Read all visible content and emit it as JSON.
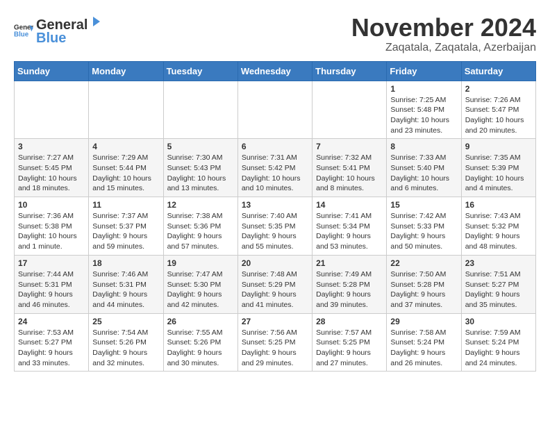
{
  "header": {
    "logo_general": "General",
    "logo_blue": "Blue",
    "month_title": "November 2024",
    "location": "Zaqatala, Zaqatala, Azerbaijan"
  },
  "days_of_week": [
    "Sunday",
    "Monday",
    "Tuesday",
    "Wednesday",
    "Thursday",
    "Friday",
    "Saturday"
  ],
  "weeks": [
    [
      {
        "day": "",
        "info": ""
      },
      {
        "day": "",
        "info": ""
      },
      {
        "day": "",
        "info": ""
      },
      {
        "day": "",
        "info": ""
      },
      {
        "day": "",
        "info": ""
      },
      {
        "day": "1",
        "info": "Sunrise: 7:25 AM\nSunset: 5:48 PM\nDaylight: 10 hours and 23 minutes."
      },
      {
        "day": "2",
        "info": "Sunrise: 7:26 AM\nSunset: 5:47 PM\nDaylight: 10 hours and 20 minutes."
      }
    ],
    [
      {
        "day": "3",
        "info": "Sunrise: 7:27 AM\nSunset: 5:45 PM\nDaylight: 10 hours and 18 minutes."
      },
      {
        "day": "4",
        "info": "Sunrise: 7:29 AM\nSunset: 5:44 PM\nDaylight: 10 hours and 15 minutes."
      },
      {
        "day": "5",
        "info": "Sunrise: 7:30 AM\nSunset: 5:43 PM\nDaylight: 10 hours and 13 minutes."
      },
      {
        "day": "6",
        "info": "Sunrise: 7:31 AM\nSunset: 5:42 PM\nDaylight: 10 hours and 10 minutes."
      },
      {
        "day": "7",
        "info": "Sunrise: 7:32 AM\nSunset: 5:41 PM\nDaylight: 10 hours and 8 minutes."
      },
      {
        "day": "8",
        "info": "Sunrise: 7:33 AM\nSunset: 5:40 PM\nDaylight: 10 hours and 6 minutes."
      },
      {
        "day": "9",
        "info": "Sunrise: 7:35 AM\nSunset: 5:39 PM\nDaylight: 10 hours and 4 minutes."
      }
    ],
    [
      {
        "day": "10",
        "info": "Sunrise: 7:36 AM\nSunset: 5:38 PM\nDaylight: 10 hours and 1 minute."
      },
      {
        "day": "11",
        "info": "Sunrise: 7:37 AM\nSunset: 5:37 PM\nDaylight: 9 hours and 59 minutes."
      },
      {
        "day": "12",
        "info": "Sunrise: 7:38 AM\nSunset: 5:36 PM\nDaylight: 9 hours and 57 minutes."
      },
      {
        "day": "13",
        "info": "Sunrise: 7:40 AM\nSunset: 5:35 PM\nDaylight: 9 hours and 55 minutes."
      },
      {
        "day": "14",
        "info": "Sunrise: 7:41 AM\nSunset: 5:34 PM\nDaylight: 9 hours and 53 minutes."
      },
      {
        "day": "15",
        "info": "Sunrise: 7:42 AM\nSunset: 5:33 PM\nDaylight: 9 hours and 50 minutes."
      },
      {
        "day": "16",
        "info": "Sunrise: 7:43 AM\nSunset: 5:32 PM\nDaylight: 9 hours and 48 minutes."
      }
    ],
    [
      {
        "day": "17",
        "info": "Sunrise: 7:44 AM\nSunset: 5:31 PM\nDaylight: 9 hours and 46 minutes."
      },
      {
        "day": "18",
        "info": "Sunrise: 7:46 AM\nSunset: 5:31 PM\nDaylight: 9 hours and 44 minutes."
      },
      {
        "day": "19",
        "info": "Sunrise: 7:47 AM\nSunset: 5:30 PM\nDaylight: 9 hours and 42 minutes."
      },
      {
        "day": "20",
        "info": "Sunrise: 7:48 AM\nSunset: 5:29 PM\nDaylight: 9 hours and 41 minutes."
      },
      {
        "day": "21",
        "info": "Sunrise: 7:49 AM\nSunset: 5:28 PM\nDaylight: 9 hours and 39 minutes."
      },
      {
        "day": "22",
        "info": "Sunrise: 7:50 AM\nSunset: 5:28 PM\nDaylight: 9 hours and 37 minutes."
      },
      {
        "day": "23",
        "info": "Sunrise: 7:51 AM\nSunset: 5:27 PM\nDaylight: 9 hours and 35 minutes."
      }
    ],
    [
      {
        "day": "24",
        "info": "Sunrise: 7:53 AM\nSunset: 5:27 PM\nDaylight: 9 hours and 33 minutes."
      },
      {
        "day": "25",
        "info": "Sunrise: 7:54 AM\nSunset: 5:26 PM\nDaylight: 9 hours and 32 minutes."
      },
      {
        "day": "26",
        "info": "Sunrise: 7:55 AM\nSunset: 5:26 PM\nDaylight: 9 hours and 30 minutes."
      },
      {
        "day": "27",
        "info": "Sunrise: 7:56 AM\nSunset: 5:25 PM\nDaylight: 9 hours and 29 minutes."
      },
      {
        "day": "28",
        "info": "Sunrise: 7:57 AM\nSunset: 5:25 PM\nDaylight: 9 hours and 27 minutes."
      },
      {
        "day": "29",
        "info": "Sunrise: 7:58 AM\nSunset: 5:24 PM\nDaylight: 9 hours and 26 minutes."
      },
      {
        "day": "30",
        "info": "Sunrise: 7:59 AM\nSunset: 5:24 PM\nDaylight: 9 hours and 24 minutes."
      }
    ]
  ]
}
